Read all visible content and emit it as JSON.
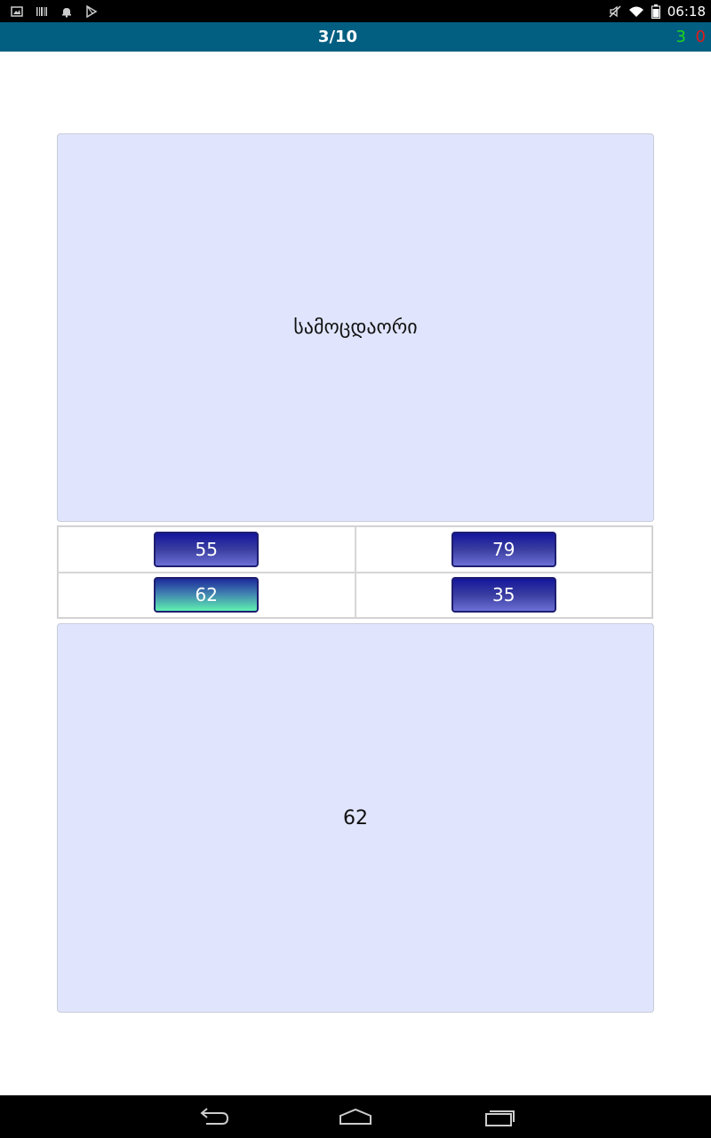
{
  "status_bar": {
    "time": "06:18",
    "left_icons": [
      "image-icon",
      "barcode-icon",
      "notification-bell-icon",
      "play-store-icon"
    ],
    "right_icons": [
      "mute-icon",
      "wifi-icon",
      "battery-icon"
    ]
  },
  "header": {
    "progress": "3/10",
    "correct_count": "3",
    "wrong_count": "0",
    "correct_color": "#1ed61e",
    "wrong_color": "#e01a1a"
  },
  "question": {
    "word": "სამოცდაორი"
  },
  "options": [
    {
      "label": "55",
      "selected": false
    },
    {
      "label": "79",
      "selected": false
    },
    {
      "label": "62",
      "selected": true
    },
    {
      "label": "35",
      "selected": false
    }
  ],
  "answer": {
    "value": "62"
  },
  "nav": {
    "buttons": [
      "back-icon",
      "home-icon",
      "recent-apps-icon"
    ]
  },
  "colors": {
    "header_bg": "#035f82",
    "card_bg": "#e0e5fd",
    "button_dark": "#14169c",
    "button_selected_bottom": "#5ff0b0"
  }
}
